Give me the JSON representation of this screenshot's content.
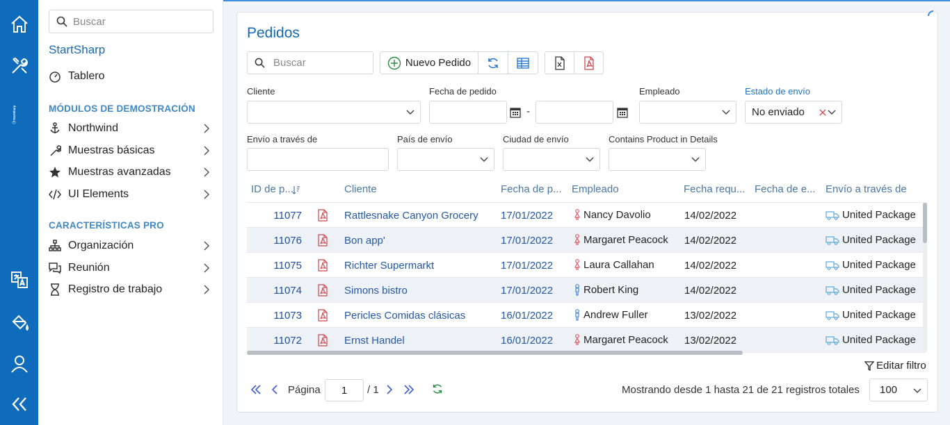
{
  "rail": {
    "brand_vertical": "StartSharp",
    "icons": [
      "home-icon",
      "tools-icon",
      "translate-icon",
      "paint-bucket-icon",
      "user-icon",
      "collapse-icon"
    ]
  },
  "nav": {
    "search_placeholder": "Buscar",
    "brand": "StartSharp",
    "dashboard": "Tablero",
    "section_demo": "MÓDULOS DE DEMOSTRACIÓN",
    "demo_items": [
      {
        "label": "Northwind",
        "icon": "anchor-icon"
      },
      {
        "label": "Muestras básicas",
        "icon": "wrench-icon"
      },
      {
        "label": "Muestras avanzadas",
        "icon": "star-icon"
      },
      {
        "label": "UI Elements",
        "icon": "code-icon"
      }
    ],
    "section_pro": "CARACTERÍSTICAS PRO",
    "pro_items": [
      {
        "label": "Organización",
        "icon": "sitemap-icon"
      },
      {
        "label": "Reunión",
        "icon": "chat-icon"
      },
      {
        "label": "Registro de trabajo",
        "icon": "hourglass-icon"
      }
    ]
  },
  "page": {
    "title": "Pedidos",
    "search_placeholder": "Buscar",
    "new_order_label": "Nuevo Pedido"
  },
  "filters": {
    "cliente": "Cliente",
    "fecha_pedido": "Fecha de pedido",
    "range_sep": "-",
    "empleado": "Empleado",
    "estado_envio": "Estado de envío",
    "estado_envio_value": "No enviado",
    "envio_traves": "Envío a través de",
    "pais_envio": "País de envío",
    "ciudad_envio": "Ciudad de envío",
    "contains_product": "Contains Product in Details"
  },
  "grid": {
    "columns": [
      "ID de p...",
      "Cliente",
      "Fecha de p...",
      "Empleado",
      "Fecha requ...",
      "Fecha de e...",
      "Envío a través de"
    ],
    "rows": [
      {
        "id": "11077",
        "cliente": "Rattlesnake Canyon Grocery",
        "fecha": "17/01/2022",
        "empleado": "Nancy Davolio",
        "genero": "female",
        "requerida": "14/02/2022",
        "envio": "",
        "via": "United Package"
      },
      {
        "id": "11076",
        "cliente": "Bon app'",
        "fecha": "17/01/2022",
        "empleado": "Margaret Peacock",
        "genero": "female",
        "requerida": "14/02/2022",
        "envio": "",
        "via": "United Package"
      },
      {
        "id": "11075",
        "cliente": "Richter Supermarkt",
        "fecha": "17/01/2022",
        "empleado": "Laura Callahan",
        "genero": "female",
        "requerida": "14/02/2022",
        "envio": "",
        "via": "United Package"
      },
      {
        "id": "11074",
        "cliente": "Simons bistro",
        "fecha": "17/01/2022",
        "empleado": "Robert King",
        "genero": "male",
        "requerida": "14/02/2022",
        "envio": "",
        "via": "United Package"
      },
      {
        "id": "11073",
        "cliente": "Pericles Comidas clásicas",
        "fecha": "16/01/2022",
        "empleado": "Andrew Fuller",
        "genero": "male",
        "requerida": "13/02/2022",
        "envio": "",
        "via": "United Package"
      },
      {
        "id": "11072",
        "cliente": "Ernst Handel",
        "fecha": "16/01/2022",
        "empleado": "Margaret Peacock",
        "genero": "female",
        "requerida": "13/02/2022",
        "envio": "",
        "via": "United Package"
      }
    ]
  },
  "footer": {
    "edit_filter": "Editar filtro",
    "page_label": "Página",
    "page_value": "1",
    "page_total": "/ 1",
    "summary": "Mostrando desde 1 hasta 21 de 21 registros totales",
    "page_size": "100"
  },
  "colors": {
    "rail": "#0f6cbd",
    "accent": "#1569b6",
    "female": "#e05a6a",
    "male": "#4a88d6",
    "pdf": "#d0474b"
  }
}
